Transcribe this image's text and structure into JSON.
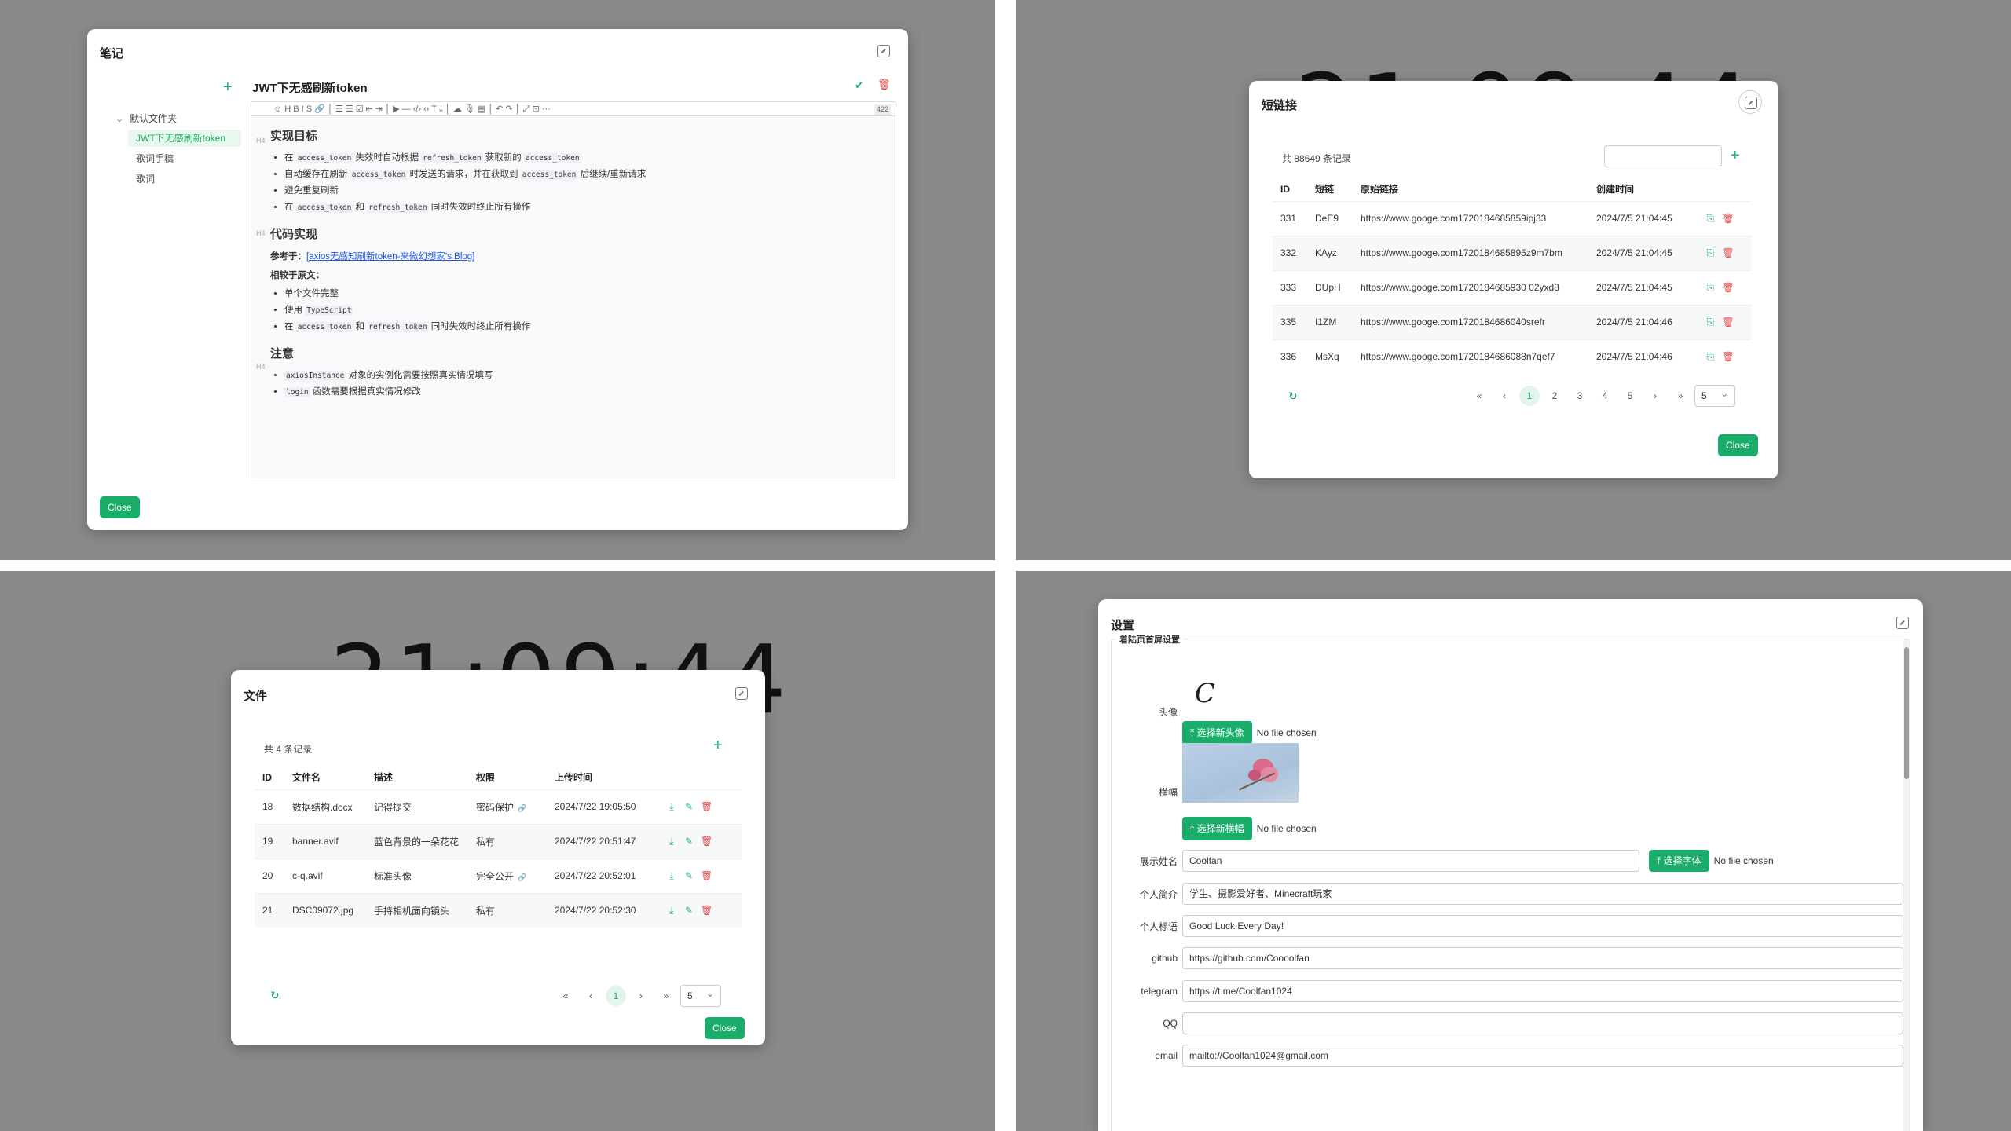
{
  "clock": "21:09:44",
  "note": {
    "title": "笔记",
    "add": "+",
    "tree_root": "默认文件夹",
    "tree_items": [
      "JWT下无感刷新token",
      "歌词手稿",
      "歌词"
    ],
    "doc_title": "JWT下无感刷新token",
    "toolbar": "☺ H B I S 🔗 │ ☰ ☰ ☑ ⇤ ⇥ │ ▶ — ‹/› ‹› T ⤓ │ ☁ 🎙 ▤ │ ↶ ↷ │ ⤢ ⊡ ⋯",
    "char_count": "422",
    "h4": "H4",
    "s1_heading": "实现目标",
    "s1_items": [
      [
        "在 ",
        "access_token",
        " 失效时自动根据 ",
        "refresh_token",
        " 获取新的 ",
        "access_token",
        ""
      ],
      [
        "自动缓存在刷新 ",
        "access_token",
        " 时发送的请求，并在获取到 ",
        "access_token",
        " 后继续/重新请求",
        "",
        ""
      ],
      [
        "避免重复刷新",
        "",
        "",
        "",
        "",
        "",
        ""
      ],
      [
        "在 ",
        "access_token",
        " 和 ",
        "refresh_token",
        " 同时失效时终止所有操作",
        "",
        ""
      ]
    ],
    "s2_heading": "代码实现",
    "ref_label": "参考于：",
    "ref_link": "[axios无感知刷新token-来微幻想家's Blog]",
    "compare_label": "相较于原文：",
    "s2_items": [
      [
        "单个文件完整",
        "",
        ""
      ],
      [
        "使用 ",
        "TypeScript",
        ""
      ],
      [
        "在 ",
        "access_token",
        " 和 "
      ]
    ],
    "s2_item3_tail_code": "refresh_token",
    "s2_item3_tail": " 同时失效时终止所有操作",
    "s3_heading": "注意",
    "s3_items": [
      [
        "",
        "axiosInstance",
        " 对象的实例化需要按照真实情况填写"
      ],
      [
        "",
        "login",
        " 函数需要根据真实情况修改"
      ]
    ],
    "close": "Close"
  },
  "shortlink": {
    "title": "短链接",
    "count": "共 88649 条记录",
    "add": "+",
    "headers": [
      "ID",
      "短链",
      "原始链接",
      "创建时间"
    ],
    "rows": [
      [
        "331",
        "DeE9",
        "https://www.googe.com1720184685859ipj33",
        "2024/7/5 21:04:45"
      ],
      [
        "332",
        "KAyz",
        "https://www.googe.com1720184685895z9m7bm",
        "2024/7/5 21:04:45"
      ],
      [
        "333",
        "DUpH",
        "https://www.googe.com1720184685930 02yxd8",
        "2024/7/5 21:04:45"
      ],
      [
        "335",
        "I1ZM",
        "https://www.googe.com1720184686040srefr",
        "2024/7/5 21:04:46"
      ],
      [
        "336",
        "MsXq",
        "https://www.googe.com1720184686088n7qef7",
        "2024/7/5 21:04:46"
      ]
    ],
    "pages": [
      "«",
      "‹",
      "1",
      "2",
      "3",
      "4",
      "5",
      "›",
      "»"
    ],
    "page_size": "5",
    "refresh": "↻",
    "close": "Close"
  },
  "files": {
    "title": "文件",
    "count": "共 4 条记录",
    "add": "+",
    "headers": [
      "ID",
      "文件名",
      "描述",
      "权限",
      "上传时间"
    ],
    "rows": [
      [
        "18",
        "数据结构.docx",
        "记得提交",
        "密码保护",
        "2024/7/22 19:05:50"
      ],
      [
        "19",
        "banner.avif",
        "蓝色背景的一朵花花",
        "私有",
        "2024/7/22 20:51:47"
      ],
      [
        "20",
        "c-q.avif",
        "标准头像",
        "完全公开",
        "2024/7/22 20:52:01"
      ],
      [
        "21",
        "DSC09072.jpg",
        "手持相机面向镜头",
        "私有",
        "2024/7/22 20:52:30"
      ]
    ],
    "pages": [
      "«",
      "‹",
      "1",
      "›",
      "»"
    ],
    "page_size": "5",
    "refresh": "↻",
    "close": "Close"
  },
  "settings": {
    "title": "设置",
    "section": "着陆页首屏设置",
    "avatar_label": "头像",
    "avatar_glyph": "C",
    "choose_avatar": "选择新头像",
    "banner_label": "横幅",
    "choose_banner": "选择新横幅",
    "no_file": "No file chosen",
    "name_label": "展示姓名",
    "name_value": "Coolfan",
    "choose_font": "选择字体",
    "bio_label": "个人简介",
    "bio_value": "学生、摄影爱好者、Minecraft玩家",
    "motto_label": "个人标语",
    "motto_value": "Good Luck Every Day!",
    "github_label": "github",
    "github_value": "https://github.com/Coooolfan",
    "telegram_label": "telegram",
    "telegram_value": "https://t.me/Coolfan1024",
    "qq_label": "QQ",
    "qq_value": "",
    "email_label": "email",
    "email_value": "mailto://Coolfan1024@gmail.com"
  }
}
